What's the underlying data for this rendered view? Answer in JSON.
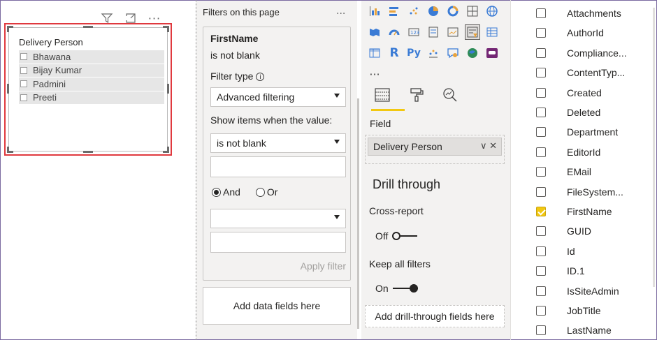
{
  "slicer": {
    "title": "Delivery Person",
    "items": [
      "Bhawana",
      "Bijay Kumar",
      "Padmini",
      "Preeti"
    ],
    "header_icons": [
      "filter-icon",
      "focus-mode-icon",
      "more-options-icon"
    ]
  },
  "filters": {
    "heading": "Filters on this page",
    "more": "...",
    "card": {
      "field": "FirstName",
      "summary": "is not blank",
      "filter_type_label": "Filter type",
      "filter_type_value": "Advanced filtering",
      "show_items_label": "Show items when the value:",
      "condition1": "is not blank",
      "condition1_input": "",
      "and_label": "And",
      "or_label": "Or",
      "selected_logic": "And",
      "condition2": "",
      "condition2_input": "",
      "apply_label": "Apply filter"
    },
    "add_fields": "Add data fields here"
  },
  "visualizations": {
    "icons": [
      "stacked-column-chart-icon",
      "stacked-bar-chart-icon",
      "scatter-chart-icon",
      "pie-chart-icon",
      "donut-chart-icon",
      "treemap-icon",
      "map-icon",
      "filled-map-icon",
      "gauge-icon",
      "card-icon",
      "multi-row-card-icon",
      "kpi-icon",
      "slicer-icon",
      "table-icon",
      "matrix-icon",
      "r-visual-icon",
      "python-visual-icon",
      "key-influencers-icon",
      "qa-icon",
      "arcgis-map-icon",
      "power-apps-icon",
      "more-visuals-icon"
    ],
    "tabs": [
      "fields-tab-icon",
      "format-tab-icon",
      "analytics-tab-icon"
    ],
    "field_label": "Field",
    "field_value": "Delivery Person",
    "drill_title": "Drill through",
    "cross_report_label": "Cross-report",
    "cross_report_state": "Off",
    "keep_filters_label": "Keep all filters",
    "keep_filters_state": "On",
    "drill_add": "Add drill-through fields here"
  },
  "fields": {
    "items": [
      {
        "name": "Attachments",
        "checked": false
      },
      {
        "name": "AuthorId",
        "checked": false
      },
      {
        "name": "Compliance...",
        "checked": false
      },
      {
        "name": "ContentTyp...",
        "checked": false
      },
      {
        "name": "Created",
        "checked": false
      },
      {
        "name": "Deleted",
        "checked": false
      },
      {
        "name": "Department",
        "checked": false
      },
      {
        "name": "EditorId",
        "checked": false
      },
      {
        "name": "EMail",
        "checked": false
      },
      {
        "name": "FileSystem...",
        "checked": false
      },
      {
        "name": "FirstName",
        "checked": true
      },
      {
        "name": "GUID",
        "checked": false
      },
      {
        "name": "Id",
        "checked": false
      },
      {
        "name": "ID.1",
        "checked": false
      },
      {
        "name": "IsSiteAdmin",
        "checked": false
      },
      {
        "name": "JobTitle",
        "checked": false
      },
      {
        "name": "LastName",
        "checked": false
      }
    ]
  },
  "colors": {
    "selection_border": "#e0393e",
    "accent_yellow": "#f2c811",
    "pane_bg": "#f3f2f1"
  }
}
